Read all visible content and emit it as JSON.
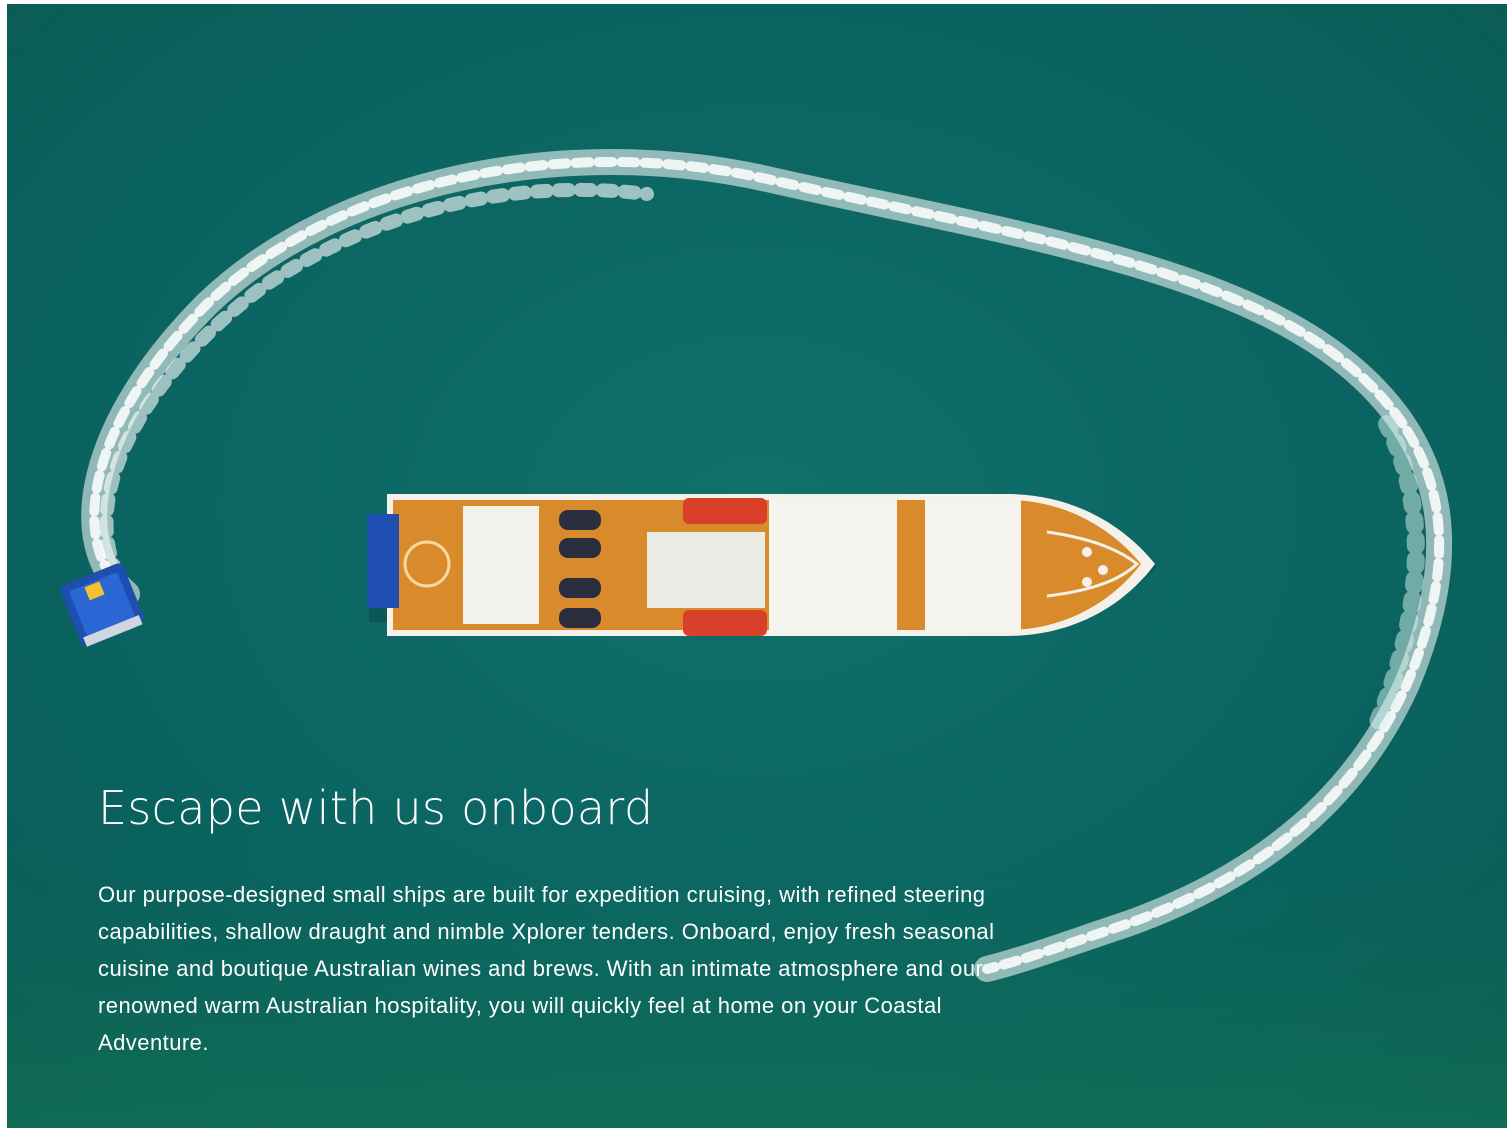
{
  "headline": "Escape with us onboard",
  "body": "Our purpose-designed small ships are built for expedition cruising, with refined steering capabilities, shallow draught and nimble Xplorer tenders. Onboard, enjoy fresh seasonal cuisine and boutique Australian wines and brews. With an intimate atmosphere and our renowned warm Australian hospitality, you will quickly feel at home on your Coastal Adventure.",
  "colors": {
    "sea": "#0a6461",
    "ship_deck": "#d98b2c",
    "ship_canopy": "#f2f1ec",
    "lifeboat": "#d8402a",
    "tender_hull": "#1e4fb0",
    "wake": "#ffffff"
  },
  "icons": [
    "expedition-ship-icon",
    "tender-boat-icon",
    "wake-trail-icon"
  ]
}
